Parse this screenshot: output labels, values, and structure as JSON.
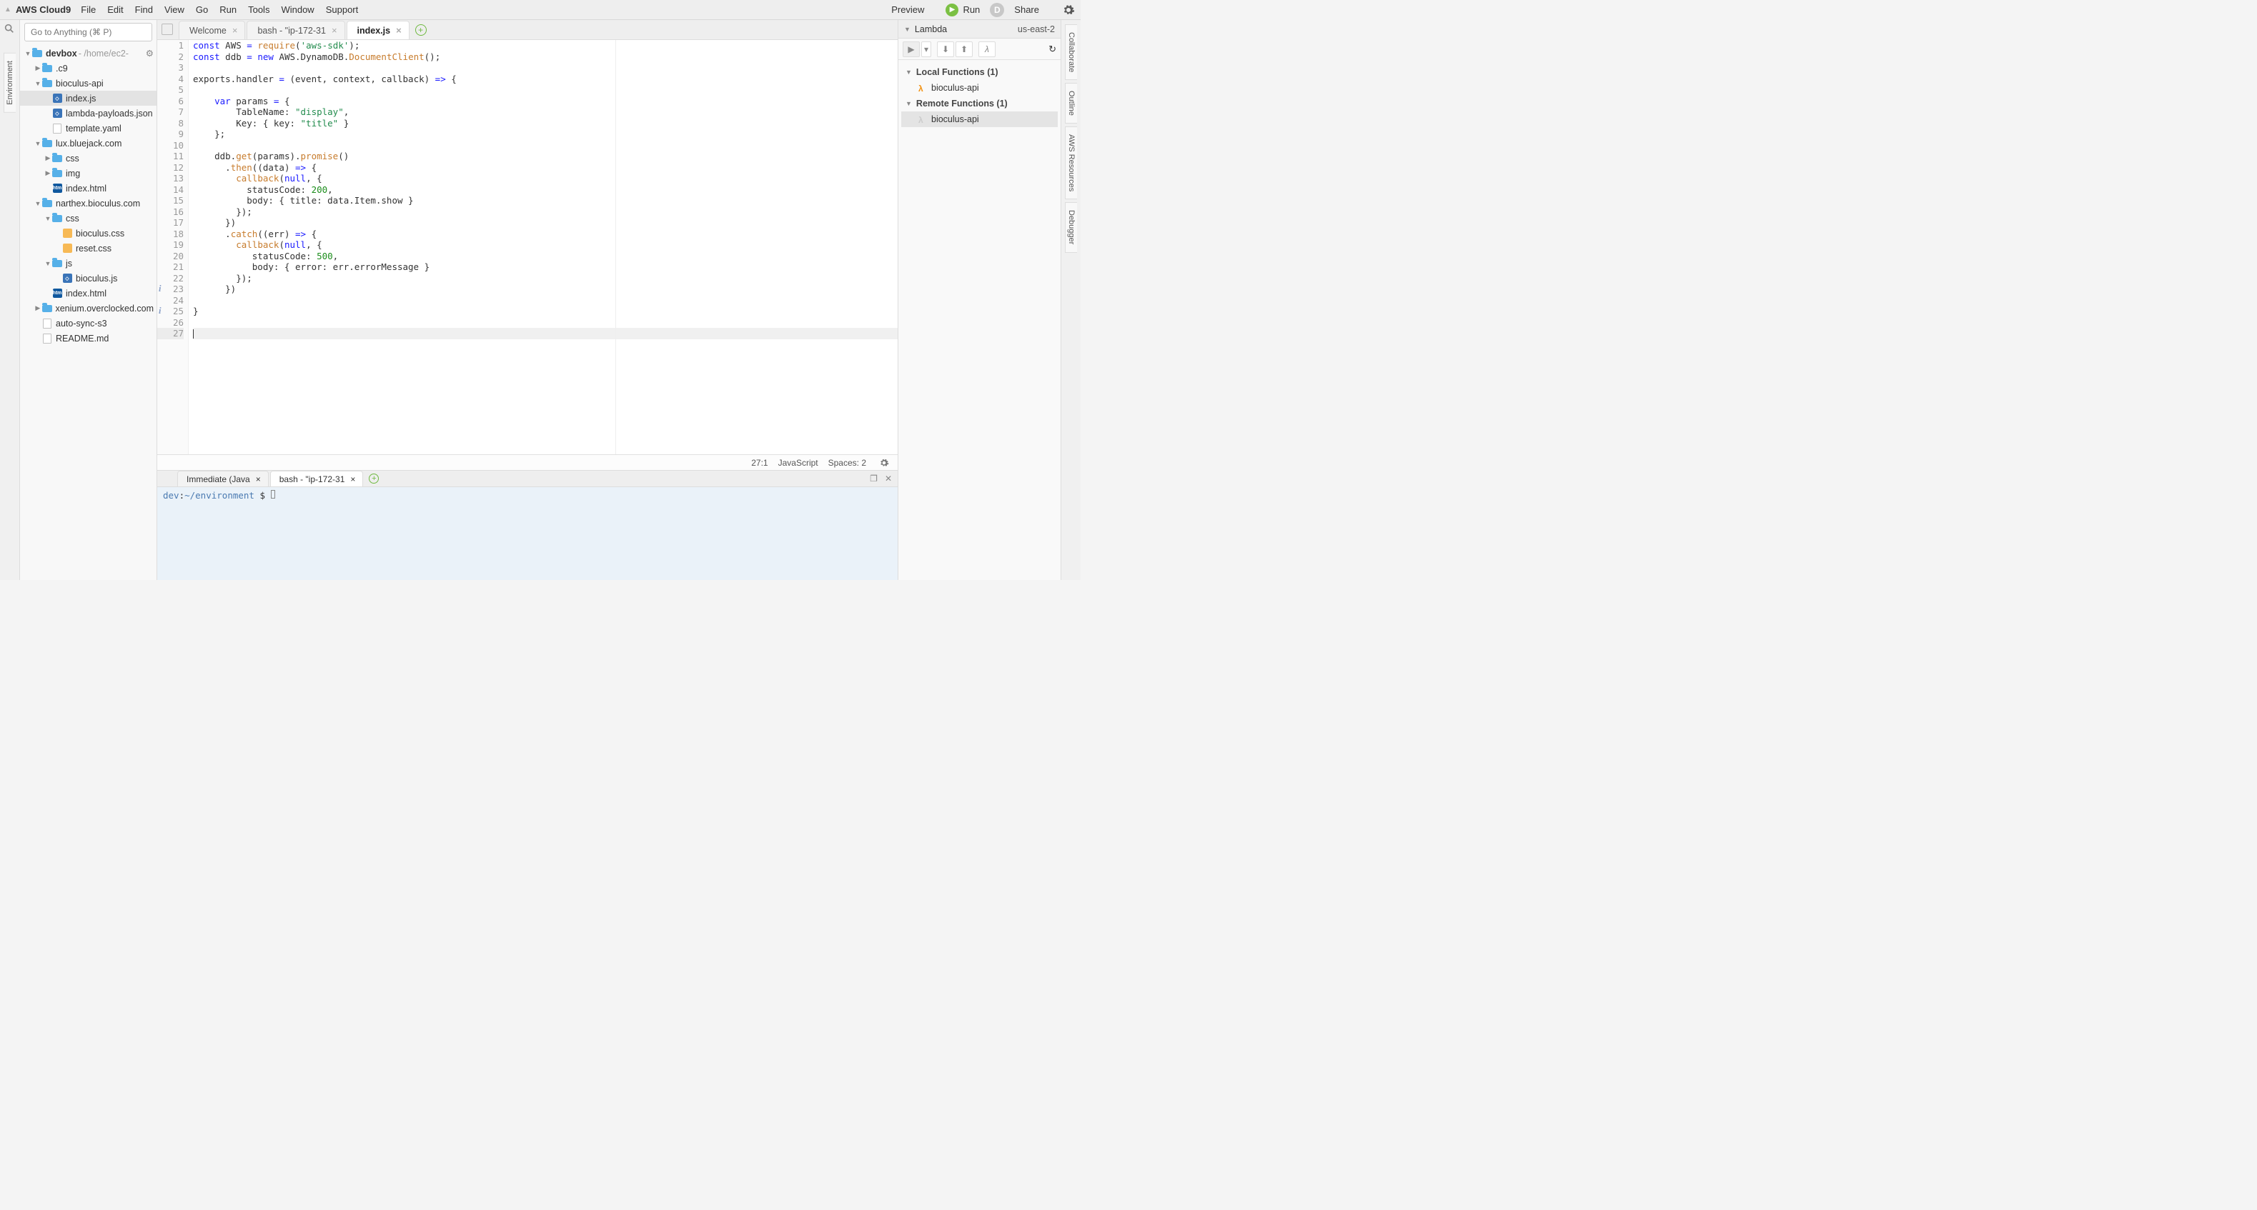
{
  "app": {
    "name": "AWS Cloud9"
  },
  "menubar": {
    "items": [
      "File",
      "Edit",
      "Find",
      "View",
      "Go",
      "Run",
      "Tools",
      "Window",
      "Support"
    ]
  },
  "menubar_right": {
    "preview": "Preview",
    "run": "Run",
    "share": "Share",
    "avatar_initial": "D"
  },
  "left_rail": {
    "tab": "Environment"
  },
  "goto": {
    "placeholder": "Go to Anything (⌘ P)"
  },
  "tree_root": {
    "name": "devbox",
    "path": "- /home/ec2-"
  },
  "tree": [
    {
      "indent": 1,
      "expand": "closed",
      "icon": "folder",
      "label": ".c9"
    },
    {
      "indent": 1,
      "expand": "open",
      "icon": "folder",
      "label": "bioculus-api"
    },
    {
      "indent": 2,
      "expand": "none",
      "icon": "js",
      "label": "index.js",
      "selected": true
    },
    {
      "indent": 2,
      "expand": "none",
      "icon": "js",
      "label": "lambda-payloads.json"
    },
    {
      "indent": 2,
      "expand": "none",
      "icon": "file",
      "label": "template.yaml"
    },
    {
      "indent": 1,
      "expand": "open",
      "icon": "folder",
      "label": "lux.bluejack.com"
    },
    {
      "indent": 2,
      "expand": "closed",
      "icon": "folder",
      "label": "css"
    },
    {
      "indent": 2,
      "expand": "closed",
      "icon": "folder",
      "label": "img"
    },
    {
      "indent": 2,
      "expand": "none",
      "icon": "html",
      "label": "index.html"
    },
    {
      "indent": 1,
      "expand": "open",
      "icon": "folder",
      "label": "narthex.bioculus.com"
    },
    {
      "indent": 2,
      "expand": "open",
      "icon": "folder",
      "label": "css"
    },
    {
      "indent": 3,
      "expand": "none",
      "icon": "css",
      "label": "bioculus.css"
    },
    {
      "indent": 3,
      "expand": "none",
      "icon": "css",
      "label": "reset.css"
    },
    {
      "indent": 2,
      "expand": "open",
      "icon": "folder",
      "label": "js"
    },
    {
      "indent": 3,
      "expand": "none",
      "icon": "js",
      "label": "bioculus.js"
    },
    {
      "indent": 2,
      "expand": "none",
      "icon": "html",
      "label": "index.html"
    },
    {
      "indent": 1,
      "expand": "closed",
      "icon": "folder",
      "label": "xenium.overclocked.com"
    },
    {
      "indent": 1,
      "expand": "none",
      "icon": "file",
      "label": "auto-sync-s3"
    },
    {
      "indent": 1,
      "expand": "none",
      "icon": "file",
      "label": "README.md"
    }
  ],
  "editor_tabs": [
    {
      "label": "Welcome",
      "active": false
    },
    {
      "label": "bash - \"ip-172-31",
      "active": false
    },
    {
      "label": "index.js",
      "active": true
    }
  ],
  "code_lines": [
    [
      [
        "kw",
        "const"
      ],
      [
        "",
        " AWS "
      ],
      [
        "op",
        "="
      ],
      [
        "",
        " "
      ],
      [
        "fn",
        "require"
      ],
      [
        "",
        "("
      ],
      [
        "str",
        "'aws-sdk'"
      ],
      [
        "",
        ");"
      ]
    ],
    [
      [
        "kw",
        "const"
      ],
      [
        "",
        " ddb "
      ],
      [
        "op",
        "="
      ],
      [
        "",
        " "
      ],
      [
        "kw",
        "new"
      ],
      [
        "",
        " AWS.DynamoDB."
      ],
      [
        "fn",
        "DocumentClient"
      ],
      [
        "",
        "();"
      ]
    ],
    [
      [
        "",
        ""
      ]
    ],
    [
      [
        "",
        "exports.handler "
      ],
      [
        "op",
        "="
      ],
      [
        "",
        " (event, context, callback) "
      ],
      [
        "op",
        "=>"
      ],
      [
        "",
        " {"
      ]
    ],
    [
      [
        "",
        ""
      ]
    ],
    [
      [
        "",
        "    "
      ],
      [
        "kw",
        "var"
      ],
      [
        "",
        " params "
      ],
      [
        "op",
        "="
      ],
      [
        "",
        " {"
      ]
    ],
    [
      [
        "",
        "        TableName: "
      ],
      [
        "str",
        "\"display\""
      ],
      [
        "",
        ","
      ]
    ],
    [
      [
        "",
        "        Key: { key: "
      ],
      [
        "str",
        "\"title\""
      ],
      [
        "",
        " }"
      ]
    ],
    [
      [
        "",
        "    };"
      ]
    ],
    [
      [
        "",
        ""
      ]
    ],
    [
      [
        "",
        "    ddb."
      ],
      [
        "fn",
        "get"
      ],
      [
        "",
        "(params)."
      ],
      [
        "fn",
        "promise"
      ],
      [
        "",
        "()"
      ]
    ],
    [
      [
        "",
        "      ."
      ],
      [
        "fn",
        "then"
      ],
      [
        "",
        "((data) "
      ],
      [
        "op",
        "=>"
      ],
      [
        "",
        " {"
      ]
    ],
    [
      [
        "",
        "        "
      ],
      [
        "fn",
        "callback"
      ],
      [
        "",
        "("
      ],
      [
        "kw",
        "null"
      ],
      [
        "",
        ", {"
      ]
    ],
    [
      [
        "",
        "          statusCode: "
      ],
      [
        "num",
        "200"
      ],
      [
        "",
        ","
      ]
    ],
    [
      [
        "",
        "          body: { title: data.Item.show }"
      ]
    ],
    [
      [
        "",
        "        });"
      ]
    ],
    [
      [
        "",
        "      })"
      ]
    ],
    [
      [
        "",
        "      ."
      ],
      [
        "fn",
        "catch"
      ],
      [
        "",
        "((err) "
      ],
      [
        "op",
        "=>"
      ],
      [
        "",
        " {"
      ]
    ],
    [
      [
        "",
        "        "
      ],
      [
        "fn",
        "callback"
      ],
      [
        "",
        "("
      ],
      [
        "kw",
        "null"
      ],
      [
        "",
        ", {"
      ]
    ],
    [
      [
        "",
        "           statusCode: "
      ],
      [
        "num",
        "500"
      ],
      [
        "",
        ","
      ]
    ],
    [
      [
        "",
        "           body: { error: err.errorMessage }"
      ]
    ],
    [
      [
        "",
        "        });"
      ]
    ],
    [
      [
        "",
        "      })"
      ]
    ],
    [
      [
        "",
        ""
      ]
    ],
    [
      [
        "",
        "}"
      ]
    ],
    [
      [
        "",
        ""
      ]
    ],
    [
      [
        "",
        ""
      ]
    ]
  ],
  "gutter_info_lines": [
    23,
    25
  ],
  "editor_cursor_line": 27,
  "status": {
    "pos": "27:1",
    "lang": "JavaScript",
    "spaces": "Spaces: 2"
  },
  "bottom_tabs": [
    {
      "label": "Immediate (Java",
      "active": false
    },
    {
      "label": "bash - \"ip-172-31",
      "active": true
    }
  ],
  "terminal": {
    "user": "dev",
    "sep": ":",
    "path": "~/environment",
    "prompt": " $ "
  },
  "lambda": {
    "title": "Lambda",
    "region": "us-east-2",
    "groups": [
      {
        "label": "Local Functions (1)",
        "items": [
          {
            "name": "bioculus-api",
            "dim": false,
            "selected": false
          }
        ]
      },
      {
        "label": "Remote Functions (1)",
        "items": [
          {
            "name": "bioculus-api",
            "dim": true,
            "selected": true
          }
        ]
      }
    ]
  },
  "right_rail": {
    "tabs": [
      "Collaborate",
      "Outline",
      "AWS Resources",
      "Debugger"
    ]
  }
}
